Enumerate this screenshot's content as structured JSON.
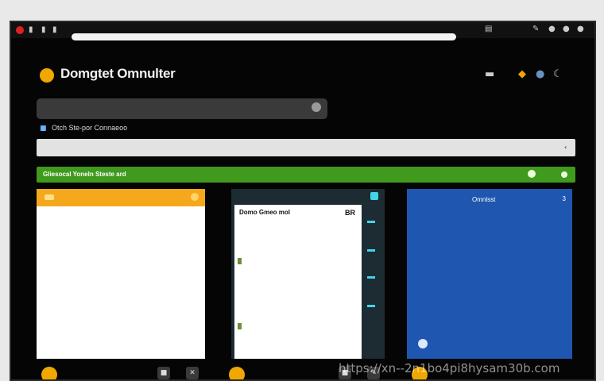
{
  "browser": {
    "tab_title": "",
    "menu_items": [
      "",
      "",
      "",
      "",
      ""
    ],
    "right_icons": [
      "settings-icon",
      "pen-icon",
      "profile-icon",
      "menu-icon",
      "close-icon"
    ]
  },
  "header": {
    "brand": "Domgtet Omnulter",
    "icons": [
      "lock-icon",
      "moon-icon"
    ]
  },
  "search": {
    "text": "",
    "placeholder": ""
  },
  "breadcrumb": {
    "text": "Otch Ste-por Connaeoo"
  },
  "toolbar": {
    "items": [
      "",
      "",
      "",
      "",
      "",
      "",
      "",
      ""
    ]
  },
  "banner": {
    "text": "Gliesocal Yoneln Steste ard"
  },
  "card_left": {
    "title": "",
    "paragraphs": [
      "",
      "",
      "",
      ""
    ],
    "link": ""
  },
  "card_middle": {
    "header": "",
    "inner_title": "Domo Gmeo mol",
    "inner_tag": "BR",
    "rows": [
      "",
      "",
      "",
      "",
      "",
      "",
      "",
      "",
      "",
      ""
    ]
  },
  "card_right": {
    "title": "Omnlsst",
    "tag": "3",
    "paragraphs": [
      "",
      "",
      ""
    ],
    "footer": ""
  },
  "bottom": {
    "left_text": "",
    "mid_text": "",
    "right_text": ""
  },
  "watermark": "https://xn--2n1bo4pi8hysam30b.com",
  "colors": {
    "accent_orange": "#f5a81b",
    "banner_green": "#3f9a1d",
    "card_blue": "#1e56b0",
    "card_teal": "#1d2b33",
    "accent_cyan": "#3fd5e6"
  }
}
